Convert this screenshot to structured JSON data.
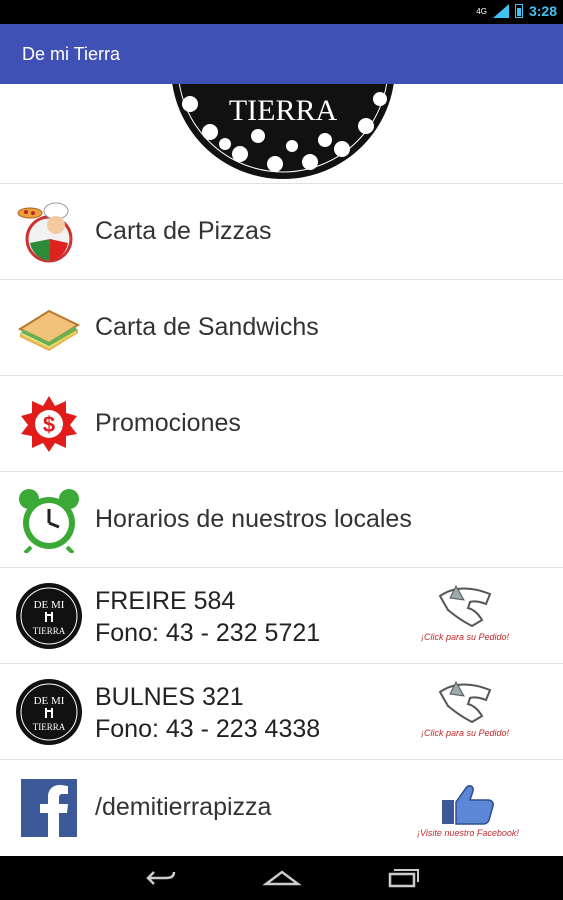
{
  "status": {
    "network": "4G",
    "time": "3:28"
  },
  "appbar": {
    "title": "De mi Tierra"
  },
  "header": {
    "logo_text": "TIERRA"
  },
  "menu": [
    {
      "label": "Carta de Pizzas",
      "icon": "pizza-chef-icon"
    },
    {
      "label": "Carta de Sandwichs",
      "icon": "sandwich-icon"
    },
    {
      "label": "Promociones",
      "icon": "dollar-badge-icon"
    },
    {
      "label": "Horarios de nuestros locales",
      "icon": "alarm-clock-icon"
    }
  ],
  "locales": [
    {
      "name": "FREIRE 584",
      "phone": "Fono: 43 - 232 5721",
      "cta": "¡Click para su Pedido!"
    },
    {
      "name": "BULNES 321",
      "phone": "Fono: 43 - 223 4338",
      "cta": "¡Click para su Pedido!"
    }
  ],
  "facebook": {
    "label": "/demitierrapizza",
    "cta": "¡Visite nuestro Facebook!"
  },
  "badge_logo": {
    "top": "DE MI",
    "bottom": "TIERRA"
  },
  "colors": {
    "appbar": "#3f51b5",
    "accent_time": "#3fc3f4",
    "cta_red": "#c0282d",
    "facebook_blue": "#3b5998"
  }
}
